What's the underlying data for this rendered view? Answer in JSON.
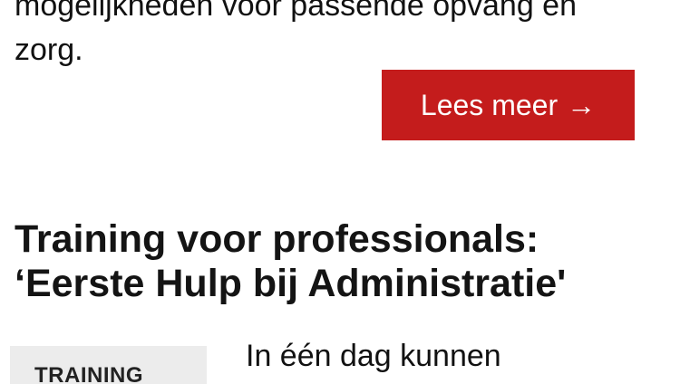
{
  "intro": {
    "text_line1": "mogelijkheden voor passende opvang en",
    "text_line2": "zorg."
  },
  "read_more": {
    "label": "Lees meer",
    "arrow": "→",
    "color": "#c41c1c"
  },
  "section": {
    "title_line1": "Training voor professionals:",
    "title_line2": "‘Eerste Hulp bij Administratie'"
  },
  "thumbnail": {
    "label": "TRAINING"
  },
  "teaser": {
    "text": "In één dag kunnen"
  }
}
